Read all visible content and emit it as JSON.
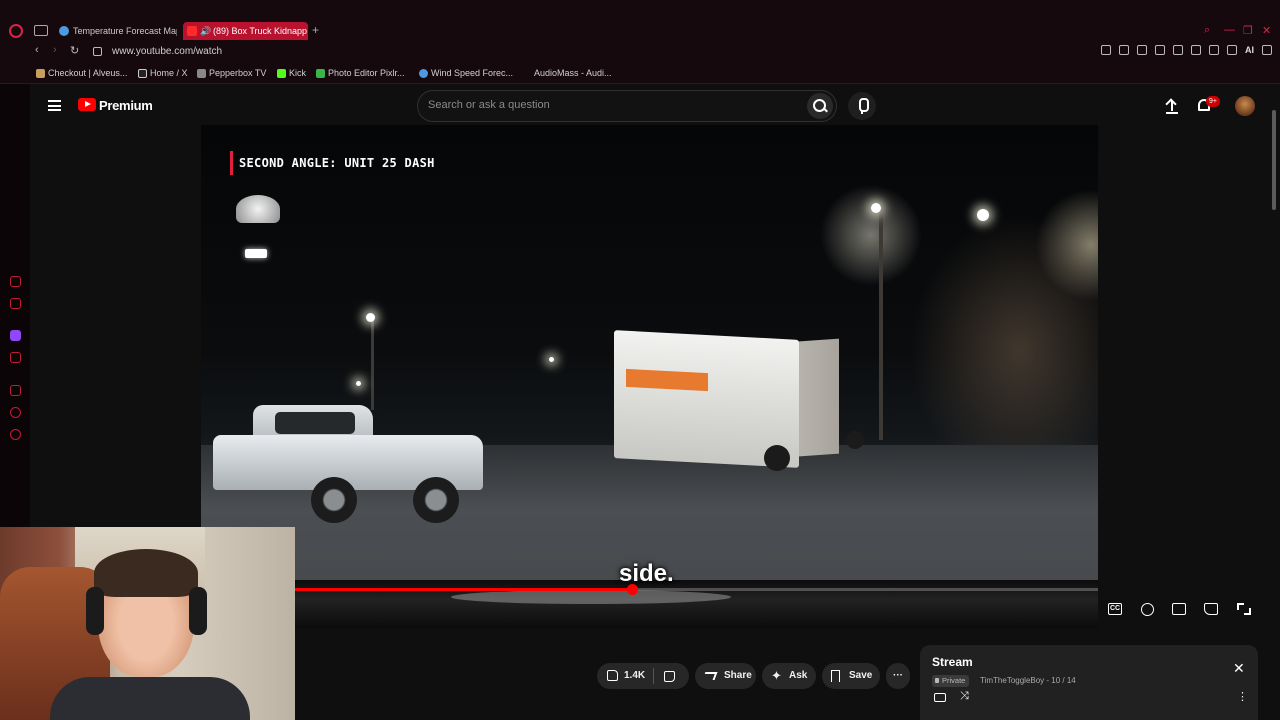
{
  "browser": {
    "tabs": [
      {
        "label": "Temperature Forecast Map",
        "active": false
      },
      {
        "label": "(89) Box Truck Kidnapp",
        "active": true
      }
    ],
    "url": "www.youtube.com/watch",
    "new_tab_icon": "plus-icon",
    "bookmarks": [
      "Checkout | Alveus...",
      "Home / X",
      "Pepperbox TV",
      "Kick",
      "Photo Editor Pixlr...",
      "Wind Speed Forec...",
      "AudioMass - Audi..."
    ],
    "ai_label": "AI",
    "accent": "#d6244a"
  },
  "youtube": {
    "brand": "Premium",
    "search_placeholder": "Search or ask a question",
    "notification_count": "9+",
    "video": {
      "overlay_label": "SECOND ANGLE: UNIT 25 DASH",
      "caption": "side.",
      "progress_fraction": 0.42
    },
    "player_controls": [
      "cc-icon",
      "gear-icon",
      "miniplayer-icon",
      "cast-icon",
      "fullscreen-icon"
    ],
    "actions": {
      "like_count": "1.4K",
      "share": "Share",
      "ask": "Ask",
      "save": "Save",
      "more": "···"
    },
    "playlist": {
      "title": "Stream",
      "privacy": "Private",
      "meta": "TimTheToggleBoy - 10 / 14"
    }
  }
}
